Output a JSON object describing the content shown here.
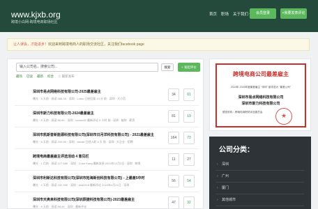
{
  "header": {
    "logo": "www.kjxb.org",
    "tagline": "跨境小白网-跨境电商职场社区",
    "nav": [
      "首页",
      "职场",
      "关于我们 ▾"
    ],
    "login_label": "会员登录",
    "register_label": "+我要发表评论"
  },
  "notice": {
    "lead": "让人误会，才能进步！",
    "rest": "欢迎来到跨境电商人的职场交流社区，关注我们facebook page"
  },
  "main": {
    "search_placeholder": "输入公司名，搜索公司...",
    "search_button": "搜索",
    "add_button": "+ 发起评价",
    "sort_options": [
      "最热",
      "已读",
      "最新",
      "综合"
    ],
    "sort_extra": "☆ 最新发布",
    "items": [
      {
        "title": "深圳市易点网络科技有限公司-2025最差雇主",
        "meta": "曝光 · 8 天前 · 阅读 588,3K · 深圳 · Lotus 已经回复 13 分 前 · 深圳 · 大小范",
        "c1": "34",
        "c2": "61",
        "green": true
      },
      {
        "title": "深圳市斯力科技有限公司-2024最差雇主",
        "meta": "曝光 · 8 天前 · 阅读 86,6K · 深圳 · ccxiao52 最新评论 6 小时 前 · 深圳 · 被称 · 薪资",
        "c1": "81",
        "c2": "19",
        "green": true
      },
      {
        "title": "深圳市凯斯普新能源科技有限公司(深圳市日月洋科技有限公司) - 2021最差雇主",
        "meta": "曝光 · 8 天前 · 阅读 200,5K · 深圳 · abcdd 已经入职 8 天 前 · 深圳 · 大企业 · 招聘",
        "c1": "164",
        "c2": "73",
        "green": true
      },
      {
        "title": "跨境电商最差雇主评选活动 4 意见栏",
        "meta": "曝光 · 1 月前 · 阅读 127,68K · 深圳 · Cube Kang 最新发表 2024年12月3日 · 深圳 · 跨境",
        "c1": "11",
        "c2": "27",
        "green": false
      },
      {
        "title": "深圳市利新达科技有限公司(深圳市拓海新创科技有限公司) - 上最差5中时",
        "meta": "曝光 · 4 天前 · 阅读 152,39K · 深圳 · sbd4318 最新评论 2024年4月21日 · 深圳",
        "c1": "56",
        "c2": "54",
        "green": true
      },
      {
        "title": "深圳市天奥来科技有限公司(深圳辰捷科技有限公司)-2023最差雇主",
        "meta": "曝光 · 8 天前 · 阅读 88,4K · 深圳 · 最新评论",
        "c1": "47",
        "c2": "32",
        "green": true
      }
    ]
  },
  "ad": {
    "title": "跨境电商公司最差雇主",
    "subtitle": "2024年-2025年度最差雇主 \"深圳\" 被评选为 \"最差公司\"",
    "company1": "深圳市易点网络科技有限公司",
    "connector": "&",
    "company2": "深圳市斯力科技有限公司",
    "footer": "颁发机构：跨境电商职场评选委员会"
  },
  "categories": {
    "title": "公司分类：",
    "items": [
      "深圳",
      "广州",
      "厦门",
      "其他城市"
    ]
  },
  "colors": {
    "header_bg": "#244a3b",
    "accent_green": "#5cb85c",
    "notice_red": "#d9534f",
    "cert_red": "#c9302c",
    "category_bg": "#2e3338"
  }
}
